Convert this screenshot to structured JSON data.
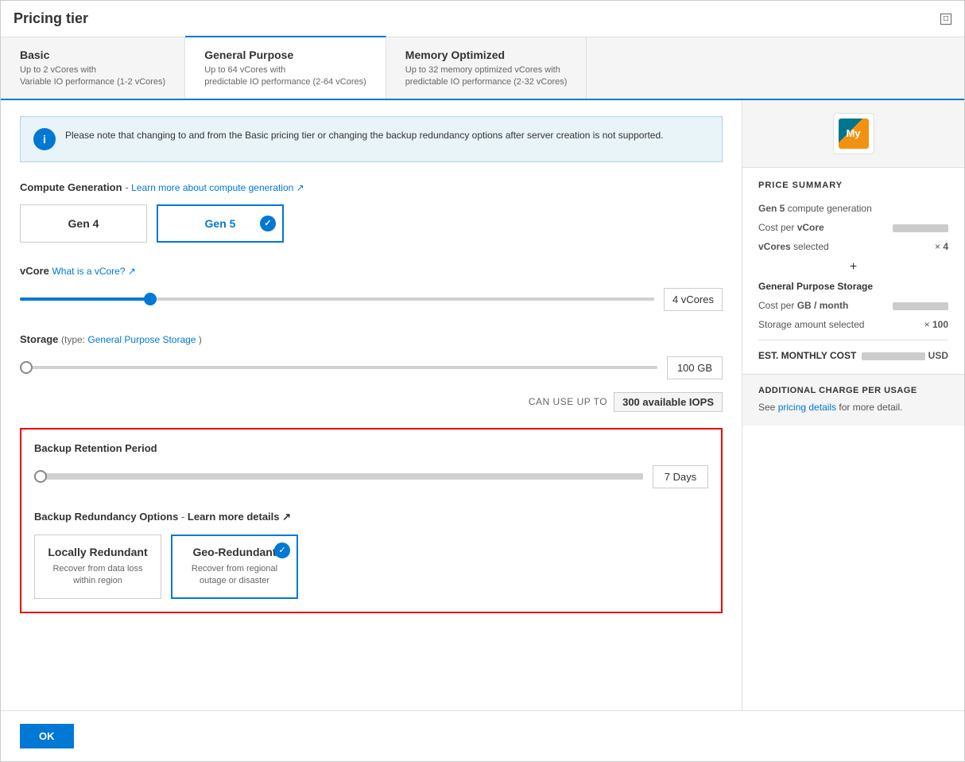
{
  "dialog": {
    "title": "Pricing tier"
  },
  "tabs": [
    {
      "id": "basic",
      "name": "Basic",
      "desc": "Up to 2 vCores with\nVariable IO performance (1-2 vCores)",
      "active": false
    },
    {
      "id": "general",
      "name": "General Purpose",
      "desc": "Up to 64 vCores with\npredictable IO performance (2-64 vCores)",
      "active": true
    },
    {
      "id": "memory",
      "name": "Memory Optimized",
      "desc": "Up to 32 memory optimized vCores with\npredictable IO performance (2-32 vCores)",
      "active": false
    }
  ],
  "info": {
    "text": "Please note that changing to and from the Basic pricing tier or changing the backup redundancy options after server creation is not supported."
  },
  "compute": {
    "label": "Compute Generation",
    "link_text": "Learn more about compute generation",
    "link_symbol": "↗",
    "dash": "-",
    "gen4_label": "Gen 4",
    "gen5_label": "Gen 5"
  },
  "vcore": {
    "label": "vCore",
    "link_text": "What is a vCore?",
    "link_symbol": "↗",
    "dash": "-",
    "value": "4 vCores",
    "slider_value": 20
  },
  "storage": {
    "label": "Storage",
    "type_label": "(type:",
    "type_value": "General Purpose Storage",
    "type_close": ")",
    "value": "100 GB",
    "slider_value": 0
  },
  "iops": {
    "label": "CAN USE UP TO",
    "value": "300 available IOPS"
  },
  "backup": {
    "retention_label": "Backup Retention Period",
    "retention_value": "7 Days",
    "retention_slider": 0,
    "redundancy_label": "Backup Redundancy Options",
    "redundancy_link": "Learn more details",
    "redundancy_link_symbol": "↗",
    "redundancy_dash": "-",
    "locally_name": "Locally Redundant",
    "locally_desc": "Recover from data loss within region",
    "geo_name": "Geo-Redundant",
    "geo_desc": "Recover from regional outage or disaster"
  },
  "price_summary": {
    "title": "PRICE SUMMARY",
    "gen_label": "Gen 5",
    "gen_suffix": "compute generation",
    "cost_per_vcore_label": "Cost per",
    "cost_per_vcore_bold": "vCore",
    "vcores_selected_label": "vCores",
    "vcores_selected_suffix": "selected",
    "vcores_count": "4",
    "storage_section_label": "General Purpose Storage",
    "cost_per_gb_label": "Cost per",
    "cost_per_gb_bold": "GB / month",
    "storage_amount_label": "Storage amount selected",
    "storage_amount_value": "100",
    "est_label": "EST. MONTHLY COST",
    "est_usd": "USD"
  },
  "additional": {
    "title": "ADDITIONAL CHARGE PER USAGE",
    "text": "See",
    "link": "pricing details",
    "text2": "for more detail."
  },
  "ok_button": "OK"
}
